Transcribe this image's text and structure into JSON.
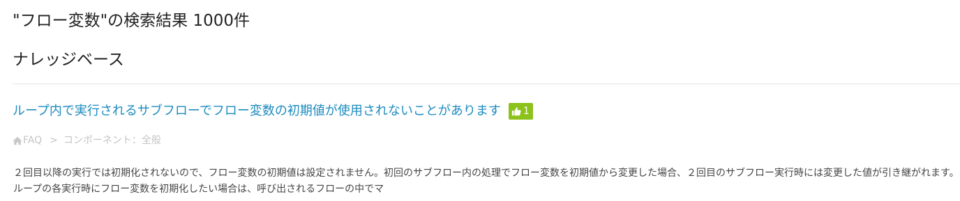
{
  "search": {
    "title": "\"フロー変数\"の検索結果 1000件"
  },
  "section": {
    "title": "ナレッジベース"
  },
  "result": {
    "title": "ループ内で実行されるサブフローでフロー変数の初期値が使用されないことがあります",
    "likes": "1",
    "like_icon": "thumbs-up-icon",
    "like_color": "#8cc21a",
    "link_color": "#1b8bbf",
    "breadcrumb": {
      "home_icon": "home-icon",
      "category": "FAQ",
      "separator": ">",
      "subcategory": "コンポーネント：全般"
    },
    "snippet": "２回目以降の実行では初期化されないので、フロー変数の初期値は設定されません。初回のサブフロー内の処理でフロー変数を初期値から変更した場合、２回目のサブフロー実行時には変更した値が引き継がれます。 ループの各実行時にフロー変数を初期化したい場合は、呼び出されるフローの中でマ"
  }
}
